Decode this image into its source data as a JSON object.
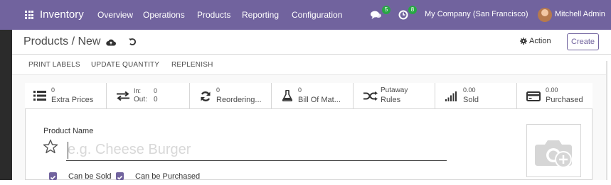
{
  "navbar": {
    "app_name": "Inventory",
    "menu": [
      "Overview",
      "Operations",
      "Products",
      "Reporting",
      "Configuration"
    ],
    "messages_count": "5",
    "activities_count": "8",
    "company": "My Company (San Francisco)",
    "user": "Mitchell Admin"
  },
  "control_panel": {
    "breadcrumb": "Products / New",
    "action_label": "Action",
    "create_label": "Create"
  },
  "status_actions": [
    "PRINT LABELS",
    "UPDATE QUANTITY",
    "REPLENISH"
  ],
  "smart_buttons": {
    "extra_prices": {
      "value": "0",
      "label": "Extra Prices"
    },
    "in_out": {
      "in_label": "In:",
      "in_value": "0",
      "out_label": "Out:",
      "out_value": "0"
    },
    "reordering": {
      "value": "0",
      "label": "Reordering..."
    },
    "bom": {
      "value": "0",
      "label": "Bill Of Mat..."
    },
    "putaway": {
      "label1": "Putaway",
      "label2": "Rules"
    },
    "sold": {
      "value": "0.00",
      "label": "Sold"
    },
    "purchased": {
      "value": "0.00",
      "label": "Purchased"
    }
  },
  "form": {
    "product_name_label": "Product Name",
    "product_name_placeholder": "e.g. Cheese Burger",
    "product_name_value": "",
    "can_be_sold_label": "Can be Sold",
    "can_be_sold": true,
    "can_be_purchased_label": "Can be Purchased",
    "can_be_purchased": true
  },
  "colors": {
    "brand": "#71639e",
    "badge_green": "#28a745"
  }
}
